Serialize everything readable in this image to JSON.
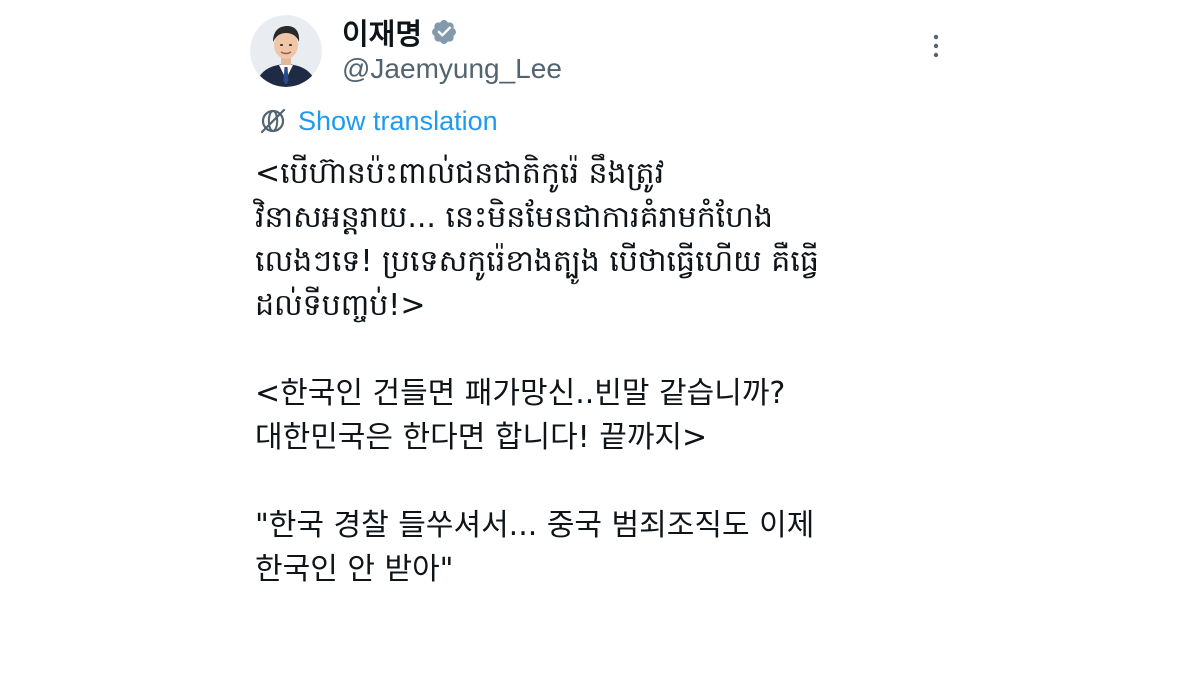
{
  "tweet": {
    "author": {
      "display_name": "이재명",
      "handle": "@Jaemyung_Lee",
      "verified": true
    },
    "translate_label": "Show translation",
    "paragraphs": [
      "<បើហ៊ានប៉ះពាល់ជនជាតិកូរ៉េ នឹងត្រូវ\nវិនាសអន្តរាយ... នេះមិនមែនជាការគំរាមកំហែង\nលេងៗទេ! ប្រទេសកូរ៉េខាងត្បូង បើថាធ្វើហើយ គឺធ្វើ\nដល់ទីបញ្ចប់!>",
      "<한국인 건들면 패가망신..빈말 같습니까?\n대한민국은 한다면 합니다! 끝까지>",
      "\"한국 경찰 들쑤셔서... 중국 범죄조직도 이제\n한국인 안 받아\""
    ]
  },
  "colors": {
    "text_primary": "#0f1419",
    "text_secondary": "#536471",
    "link": "#1d9bf0",
    "verified_badge": "#829aab"
  },
  "icons": {
    "verified": "verified-badge-icon",
    "more": "more-vertical-icon",
    "translate": "translate-globe-icon"
  }
}
